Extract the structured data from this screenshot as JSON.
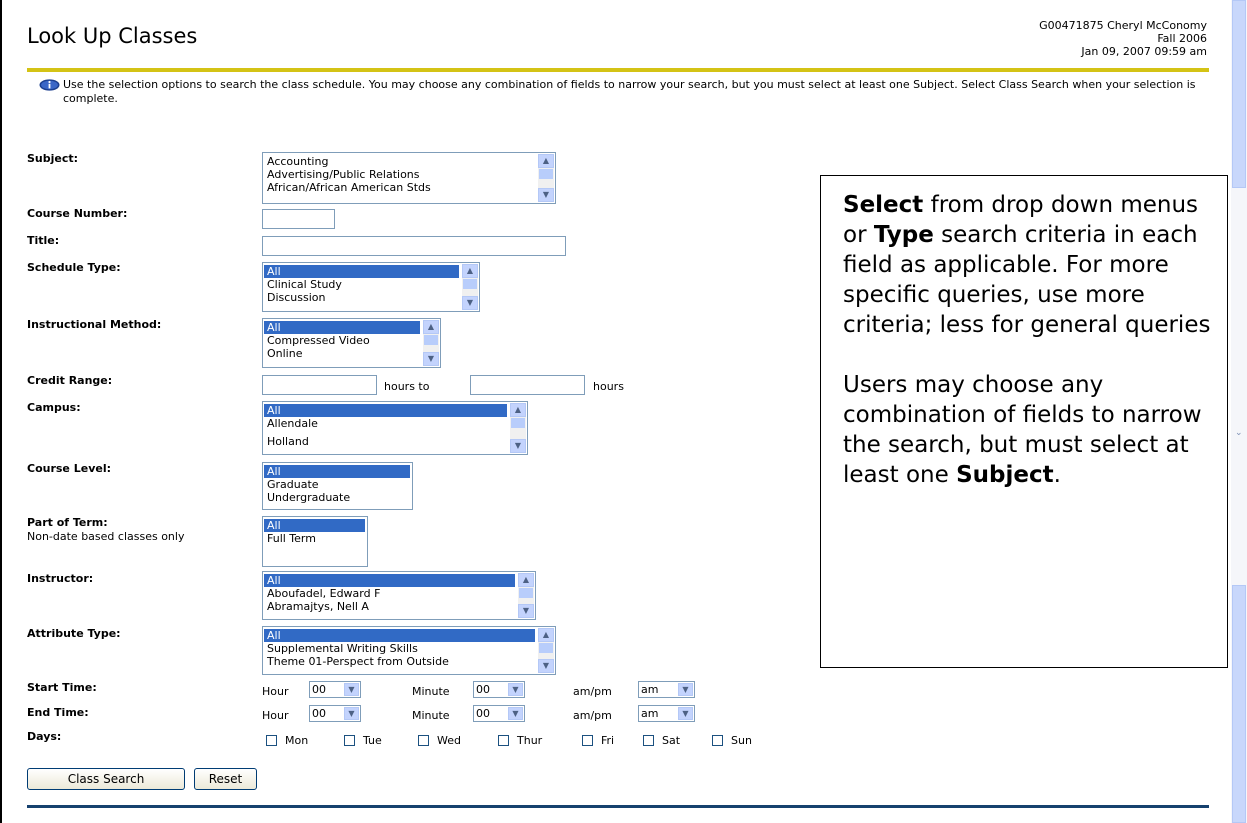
{
  "header": {
    "title": "Look Up Classes",
    "user": "G00471875 Cheryl McConomy",
    "term": "Fall 2006",
    "datetime": "Jan 09, 2007 09:59 am"
  },
  "info": {
    "text": "Use the selection options to search the class schedule. You may choose any combination of fields to narrow your search, but you must select at least one Subject. Select Class Search when your selection is complete."
  },
  "form": {
    "subject": {
      "label": "Subject:",
      "options": [
        "Accounting",
        "Advertising/Public Relations",
        "African/African American Stds"
      ]
    },
    "course_number": {
      "label": "Course Number:"
    },
    "title": {
      "label": "Title:"
    },
    "schedule_type": {
      "label": "Schedule Type:",
      "options": [
        "All",
        "Clinical Study",
        "Discussion"
      ]
    },
    "instructional_method": {
      "label": "Instructional Method:",
      "options": [
        "All",
        "Compressed Video",
        "Online"
      ]
    },
    "credit_range": {
      "label": "Credit Range:",
      "hours_to": "hours to",
      "hours": "hours"
    },
    "campus": {
      "label": "Campus:",
      "options": [
        "All",
        "Allendale",
        "Holland"
      ]
    },
    "course_level": {
      "label": "Course Level:",
      "options": [
        "All",
        "Graduate",
        "Undergraduate"
      ]
    },
    "part_of_term": {
      "label": "Part of Term:",
      "sublabel": "Non-date based classes only",
      "options": [
        "All",
        "Full Term"
      ]
    },
    "instructor": {
      "label": "Instructor:",
      "options": [
        "All",
        "Aboufadel, Edward F",
        "Abramajtys, Nell A"
      ]
    },
    "attribute_type": {
      "label": "Attribute Type:",
      "options": [
        "All",
        "Supplemental Writing Skills",
        "Theme 01-Perspect from Outside"
      ]
    },
    "start_time": {
      "label": "Start Time:",
      "hour_label": "Hour",
      "hour": "00",
      "minute_label": "Minute",
      "minute": "00",
      "ampm_label": "am/pm",
      "ampm": "am"
    },
    "end_time": {
      "label": "End Time:",
      "hour_label": "Hour",
      "hour": "00",
      "minute_label": "Minute",
      "minute": "00",
      "ampm_label": "am/pm",
      "ampm": "am"
    },
    "days": {
      "label": "Days:",
      "items": [
        "Mon",
        "Tue",
        "Wed",
        "Thur",
        "Fri",
        "Sat",
        "Sun"
      ]
    },
    "buttons": {
      "search": "Class Search",
      "reset": "Reset"
    }
  },
  "callout": {
    "p1": {
      "b1": "Select",
      "t1": " from drop down menus or ",
      "b2": "Type",
      "t2": " search criteria in each field as applicable. For more specific queries, use more criteria; less for general queries"
    },
    "p2": {
      "t1": "Users may choose any combination of fields to narrow the search, but must select at least one ",
      "b1": "Subject",
      "t2": "."
    }
  },
  "icons": {
    "info": "info-icon",
    "arrow_up": "arrow-up-icon",
    "arrow_down": "arrow-down-icon"
  },
  "colors": {
    "header_rule": "#d4c315",
    "selection": "#316ac5",
    "bottom_rule": "#16416e"
  }
}
